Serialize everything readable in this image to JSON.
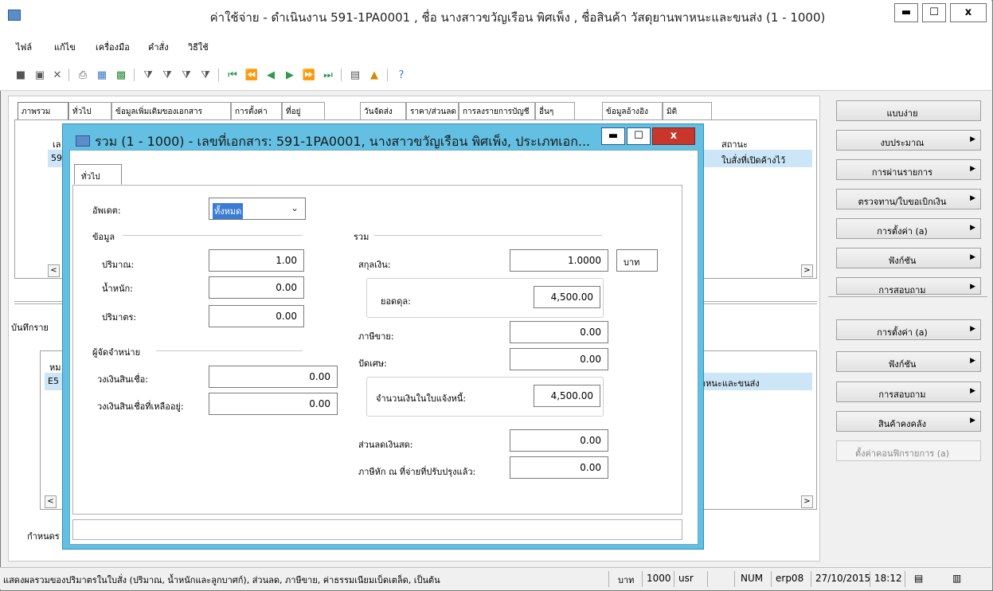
{
  "main": {
    "title": "ค่าใช้จ่าย - ดำเนินงาน 591-1PA0001 , ชื่อ นางสาวขวัญเรือน พิศเพ็ง , ชื่อสินค้า วัสดุยานพาหนะและขนส่ง (1 - 1000)",
    "minimize": "▬",
    "maximize": "☐",
    "close": "x"
  },
  "menu": {
    "items": [
      "ไฟล์",
      "แก้ไข",
      "เครื่องมือ",
      "คำสั่ง",
      "วิธีใช้"
    ]
  },
  "toolbar_icons": [
    "new-icon",
    "save-icon",
    "delete-icon",
    "print-icon",
    "preview-icon",
    "excel-icon",
    "filter-icon",
    "filter-select-icon",
    "advanced-filter-icon",
    "remove-filter-icon",
    "first-record-icon",
    "previous-page-icon",
    "previous-record-icon",
    "next-record-icon",
    "next-page-icon",
    "last-record-icon",
    "attachment-icon",
    "alert-icon",
    "help-icon"
  ],
  "tabs": [
    "ภาพรวม",
    "ทั่วไป",
    "ข้อมูลเพิ่มเติมของเอกสาร",
    "การตั้งค่า",
    "ที่อยู่",
    "วันจัดส่ง",
    "ราคา/ส่วนลด",
    "การลงรายการบัญชี",
    "อื่นๆ",
    "ข้อมูลอ้างอิง",
    "มิติ"
  ],
  "header_grid": {
    "col_left": "เล",
    "col_status": "สถานะ",
    "row_left": "59",
    "row_status": "ใบสั่งที่เปิดค้างไว้"
  },
  "lines_section": {
    "label": "บันทึกราย",
    "col_left": "หม",
    "row_left": "E5",
    "row_right": "าหนะและขนส่ง",
    "bottom_label": "กำหนดร"
  },
  "side_buttons_top": [
    {
      "label": "แบบง่าย",
      "arrow": ""
    },
    {
      "label": "งบประมาณ",
      "arrow": "▶"
    },
    {
      "label": "การผ่านรายการ",
      "arrow": "▶"
    },
    {
      "label": "ตรวจทาน/ใบขอเบิกเงิน",
      "arrow": "▶"
    },
    {
      "label": "การตั้งค่า (a)",
      "arrow": "▶"
    },
    {
      "label": "ฟังก์ชัน",
      "arrow": "▶"
    },
    {
      "label": "การสอบถาม",
      "arrow": "▶"
    }
  ],
  "side_buttons_bottom": [
    {
      "label": "การตั้งค่า (a)",
      "arrow": "▶"
    },
    {
      "label": "ฟังก์ชัน",
      "arrow": "▶"
    },
    {
      "label": "การสอบถาม",
      "arrow": "▶"
    },
    {
      "label": "สินค้าคงคลัง",
      "arrow": "▶"
    },
    {
      "label": "ตั้งค่าคอนฟิกรายการ (a)",
      "arrow": ""
    }
  ],
  "status_bar": {
    "message": "แสดงผลรวมของปริมาตรในใบสั่ง (ปริมาณ, น้ำหนักและลูกบาศก์), ส่วนลด, ภาษีขาย, ค่าธรรมเนียมเบ็ดเตล็ด, เป็นต้น",
    "currency": "บาท",
    "company": "1000",
    "user": "usr",
    "num": "NUM",
    "server": "erp08",
    "date": "27/10/2015",
    "time": "18:12"
  },
  "dialog": {
    "title": "รวม (1 - 1000) - เลขที่เอกสาร: 591-1PA0001, นางสาวขวัญเรือน พิศเพ็ง, ประเภทเอก...",
    "tab": "ทั่วไป",
    "update_label": "อัพเดต:",
    "update_value": "ทั้งหมด",
    "data_group": "ข้อมูล",
    "quantity_label": "ปริมาณ:",
    "quantity_value": "1.00",
    "weight_label": "น้ำหนัก:",
    "weight_value": "0.00",
    "volume_label": "ปริมาตร:",
    "volume_value": "0.00",
    "vendor_group": "ผู้จัดจำหน่าย",
    "credit_limit_label": "วงเงินสินเชื่อ:",
    "credit_limit_value": "0.00",
    "credit_remaining_label": "วงเงินสินเชื่อที่เหลืออยู่:",
    "credit_remaining_value": "0.00",
    "total_group": "รวม",
    "currency_label": "สกุลเงิน:",
    "currency_rate": "1.0000",
    "currency_code": "บาท",
    "balance_label": "ยอดดุล:",
    "balance_value": "4,500.00",
    "sales_tax_label": "ภาษีขาย:",
    "sales_tax_value": "0.00",
    "rounding_label": "ปัดเศษ:",
    "rounding_value": "0.00",
    "invoice_amount_label": "จำนวนเงินในใบแจ้งหนี้:",
    "invoice_amount_value": "4,500.00",
    "cash_discount_label": "ส่วนลดเงินสด:",
    "cash_discount_value": "0.00",
    "withholding_label": "ภาษีหัก ณ ที่จ่ายที่ปรับปรุงแล้ว:",
    "withholding_value": "0.00"
  }
}
